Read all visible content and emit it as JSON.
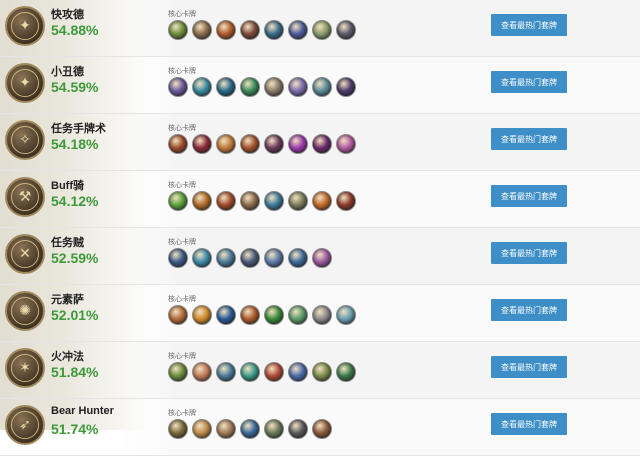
{
  "core_label": "核心卡牌",
  "button_label": "查看最热门套牌",
  "colors": {
    "winrate": "#3c9a3a",
    "button": "#3e8fc8"
  },
  "decks": [
    {
      "name": "快攻德",
      "winrate": "54.88%",
      "icon": "druid-claw-icon",
      "cards": [
        "#6b8e3a",
        "#8a6a4a",
        "#b05a2a",
        "#7a4a3a",
        "#3a6a8a",
        "#4a5a9a",
        "#8a9a6a",
        "#5a5a6a"
      ]
    },
    {
      "name": "小丑德",
      "winrate": "54.59%",
      "icon": "druid-claw-icon",
      "cards": [
        "#6a5a9a",
        "#3a8aa0",
        "#2a6a8a",
        "#3a8a5a",
        "#8a7a6a",
        "#7a6aaa",
        "#5a8a9a",
        "#4a3a6a"
      ]
    },
    {
      "name": "任务手牌术",
      "winrate": "54.18%",
      "icon": "warlock-rune-icon",
      "cards": [
        "#9a4a2a",
        "#8a2a3a",
        "#c07a3a",
        "#a0502a",
        "#6a3a5a",
        "#9a3aaa",
        "#6a2a6a",
        "#b05aa0"
      ]
    },
    {
      "name": "Buff骑",
      "winrate": "54.12%",
      "icon": "paladin-hammer-icon",
      "cards": [
        "#5aa03a",
        "#b06a2a",
        "#a04a2a",
        "#8a6a4a",
        "#3a7a9a",
        "#7a7a5a",
        "#c06a2a",
        "#8a3a2a"
      ]
    },
    {
      "name": "任务贼",
      "winrate": "52.59%",
      "icon": "rogue-dagger-icon",
      "cards": [
        "#3a5a8a",
        "#3a8aaa",
        "#4a7a9a",
        "#4a5a7a",
        "#5a7aaa",
        "#3a6a9a",
        "#9a5aa0"
      ]
    },
    {
      "name": "元素萨",
      "winrate": "52.01%",
      "icon": "shaman-totem-icon",
      "cards": [
        "#b06a3a",
        "#d08a2a",
        "#2a5a9a",
        "#aa5a2a",
        "#3a8a3a",
        "#5a9a6a",
        "#8a8a8a",
        "#6aa0b0"
      ]
    },
    {
      "name": "火冲法",
      "winrate": "51.84%",
      "icon": "mage-staff-icon",
      "cards": [
        "#6a8a3a",
        "#c07a5a",
        "#4a7a9a",
        "#3a9a8a",
        "#b04a3a",
        "#4a6aaa",
        "#7a8a4a",
        "#3a7a4a"
      ]
    },
    {
      "name": "Bear Hunter",
      "winrate": "51.74%",
      "icon": "hunter-bow-icon",
      "cards": [
        "#7a6a3a",
        "#c08a4a",
        "#a07a5a",
        "#3a6a9a",
        "#6a7a5a",
        "#5a5a5a",
        "#8a5a3a"
      ]
    }
  ]
}
